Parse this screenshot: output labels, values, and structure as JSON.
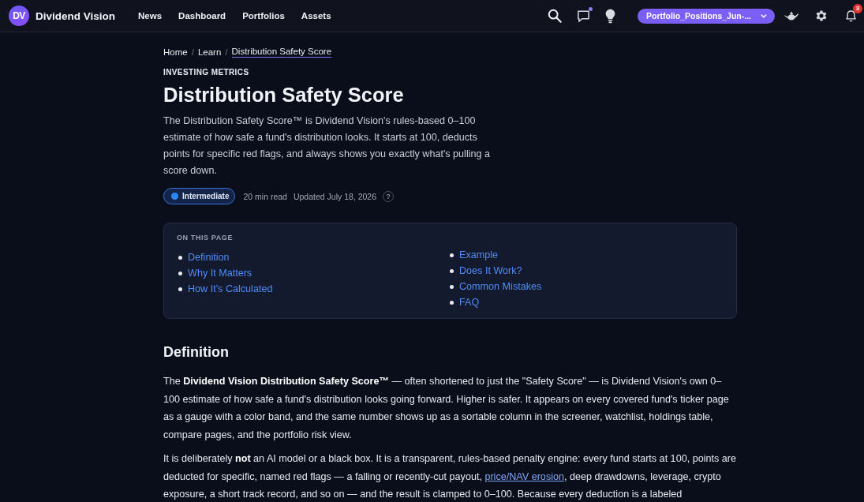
{
  "header": {
    "logo": "DV",
    "brand": "Dividend Vision",
    "nav": [
      {
        "label": "News"
      },
      {
        "label": "Dashboard"
      },
      {
        "label": "Portfolios"
      },
      {
        "label": "Assets"
      }
    ],
    "chat": {
      "unread": true
    },
    "portfolio_selector": {
      "value": "Portfolio_Positions_Jun-..."
    },
    "notifications": {
      "count": "3"
    }
  },
  "breadcrumb": {
    "items": [
      {
        "label": "Home",
        "selected": false
      },
      {
        "label": "Learn",
        "selected": false
      },
      {
        "label": "Distribution Safety Score",
        "selected": true
      }
    ],
    "separators": [
      "/",
      "/"
    ]
  },
  "article": {
    "eyebrow": "INVESTING METRICS",
    "title": "Distribution Safety Score",
    "lede": "The Distribution Safety Score™ is Dividend Vision's rules-based 0–100 estimate of how safe a fund's distribution looks. It starts at 100, deducts points for specific red flags, and always shows you exactly what's pulling a score down.",
    "meta": {
      "level": "Intermediate",
      "read_time": "20 min read",
      "updated": "Updated July 18, 2026",
      "help": "?"
    }
  },
  "toc": {
    "title": "ON THIS PAGE",
    "columns": [
      [
        {
          "label": "Definition"
        },
        {
          "label": "Why It Matters"
        },
        {
          "label": "How It's Calculated"
        }
      ],
      [
        {
          "label": "Example"
        },
        {
          "label": "Does It Work?"
        },
        {
          "label": "Common Mistakes"
        },
        {
          "label": "FAQ"
        }
      ]
    ]
  },
  "sections": [
    {
      "heading": "Definition",
      "paragraphs": [
        {
          "parts": [
            {
              "kind": "text",
              "text": "The **Dividend Vision Distribution Safety Score™** — often shortened to just the \"Safety Score\" — is Dividend Vision's own 0–100 estimate of how safe a fund's distribution looks going forward. Higher is safer. It appears on every covered fund's ticker page as a gauge with a color band, and the same number shows up as a sortable column in the screener, watchlist, holdings table, compare pages, and the portfolio risk view."
            }
          ]
        },
        {
          "parts": [
            {
              "kind": "text",
              "text": "It is deliberately **not** an AI model or a black box. It is a transparent, rules-based penalty engine: every fund starts at 100, points are deducted for specific, named red flags — a falling or recently-cut payout, "
            },
            {
              "kind": "link",
              "text": "price/NAV erosion"
            },
            {
              "kind": "text",
              "text": ", deep drawdowns, leverage, crypto exposure, a short track record, and so on — and the result is clamped to 0–100. Because every deduction is a labeled"
            }
          ]
        }
      ]
    }
  ]
}
